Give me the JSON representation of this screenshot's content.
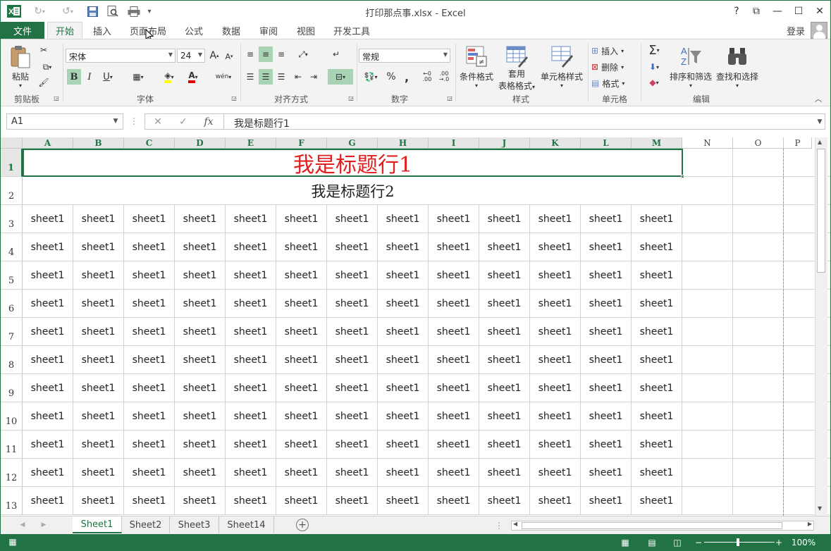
{
  "window": {
    "title": "打印那点事.xlsx - Excel",
    "help": "?",
    "ribbon_display": "⧉",
    "minimize": "—",
    "maximize": "☐",
    "close": "✕"
  },
  "quick_access": {
    "save_icon": "save-icon",
    "undo_icon": "undo-icon",
    "redo_icon": "redo-icon"
  },
  "tabs": {
    "file": "文件",
    "items": [
      "开始",
      "插入",
      "页面布局",
      "公式",
      "数据",
      "审阅",
      "视图",
      "开发工具"
    ],
    "active": "开始",
    "login": "登录"
  },
  "ribbon": {
    "clipboard": {
      "paste": "粘贴",
      "label": "剪贴板"
    },
    "font": {
      "name": "宋体",
      "size": "24",
      "grow": "A",
      "shrink": "A",
      "bold": "B",
      "italic": "I",
      "underline": "U",
      "phonetic": "wén",
      "label": "字体"
    },
    "alignment": {
      "label": "对齐方式"
    },
    "number": {
      "format": "常规",
      "percent": "%",
      "comma": ",",
      "label": "数字"
    },
    "styles": {
      "conditional": "条件格式",
      "table_line1": "套用",
      "table_line2": "表格格式",
      "cell_styles": "单元格样式",
      "label": "样式"
    },
    "cells": {
      "insert": "插入",
      "delete": "删除",
      "format": "格式",
      "label": "单元格"
    },
    "editing": {
      "sigma": "Σ",
      "sort": "排序和筛选",
      "find": "查找和选择",
      "label": "编辑"
    }
  },
  "formula_bar": {
    "name_box": "A1",
    "cancel": "✕",
    "enter": "✓",
    "fx": "fx",
    "content": "我是标题行1"
  },
  "grid": {
    "columns": [
      "A",
      "B",
      "C",
      "D",
      "E",
      "F",
      "G",
      "H",
      "I",
      "J",
      "K",
      "L",
      "M",
      "N",
      "O",
      "P"
    ],
    "rows": [
      "1",
      "2",
      "3",
      "4",
      "5",
      "6",
      "7",
      "8",
      "9",
      "10",
      "11",
      "12",
      "13"
    ],
    "title1": "我是标题行1",
    "title2": "我是标题行2",
    "cell_value": "sheet1"
  },
  "sheets": {
    "tabs": [
      "Sheet1",
      "Sheet2",
      "Sheet3",
      "Sheet14"
    ],
    "active": "Sheet1",
    "add": "+"
  },
  "status": {
    "zoom": "100%",
    "zoom_minus": "−",
    "zoom_plus": "+"
  },
  "colors": {
    "accent": "#217346",
    "title_red": "#e02020"
  }
}
